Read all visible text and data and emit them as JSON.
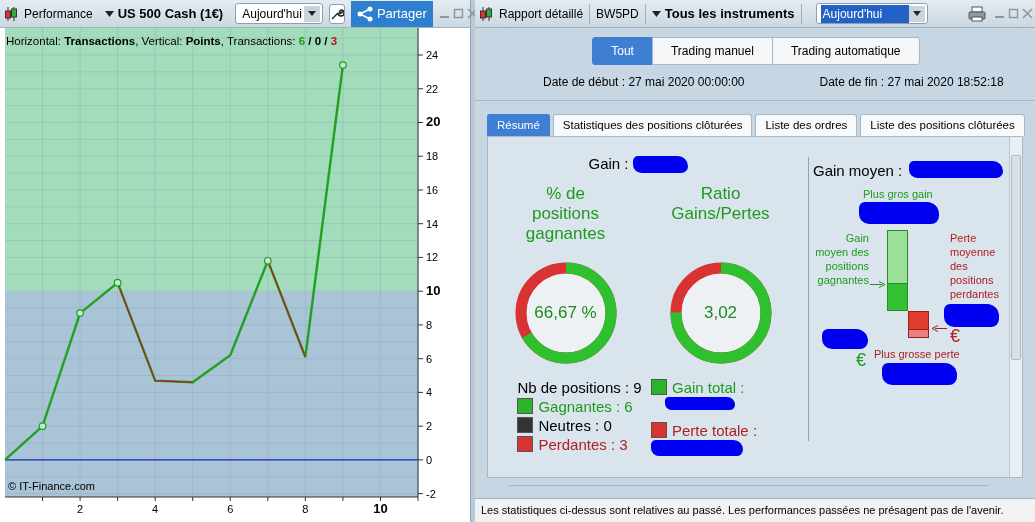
{
  "left_panel": {
    "toolbar": {
      "title": "Performance",
      "instrument": "US 500 Cash (1€)",
      "period": "Aujourd'hui",
      "share_button": "Partager"
    },
    "chart": {
      "caption": "Horizontal: **Transactions**, Vertical: **Points**, Transactions: ",
      "counts": [
        {
          "value": "6",
          "color": "#1f9a1f"
        },
        {
          "value": "0",
          "color": "#000000"
        },
        {
          "value": "3",
          "color": "#b81818"
        }
      ],
      "separator": " / ",
      "copyright": "© IT-Finance.com",
      "chart_data": {
        "type": "line",
        "x": [
          0,
          1,
          2,
          3,
          4,
          5,
          6,
          7,
          8,
          9
        ],
        "series": [
          {
            "color": "#22a022",
            "values": [
              0,
              2,
              8.7,
              10.5,
              4.7,
              4.6,
              6.2,
              11.8,
              6.1,
              23.4
            ]
          },
          {
            "color": "#b02020",
            "values": [
              null,
              null,
              null,
              10.5,
              4.7,
              4.6,
              null,
              11.8,
              6.1,
              null
            ]
          }
        ],
        "bands": [
          {
            "axis": "y",
            "from": -2.2,
            "to": 10,
            "color": "#a9c4d6"
          },
          {
            "axis": "y",
            "from": 10,
            "to": 25.6,
            "color": "#a2dcbb"
          }
        ],
        "ref_lines": [
          {
            "axis": "y",
            "value": 0,
            "color": "#1a2fb0"
          }
        ],
        "xlim": [
          0,
          11
        ],
        "ylim": [
          -2.2,
          25.6
        ],
        "xticks": [
          2,
          4,
          6,
          8,
          10
        ],
        "yticks": [
          -2,
          0,
          2,
          4,
          6,
          8,
          10,
          12,
          14,
          16,
          18,
          20,
          22,
          24
        ],
        "grid": true
      }
    }
  },
  "right_panel": {
    "toolbar": {
      "title": "Rapport détaillé",
      "account": "BW5PD",
      "instruments": "Tous les instruments",
      "period": "Aujourd'hui"
    },
    "modes": [
      {
        "label": "Tout",
        "selected": true
      },
      {
        "label": "Trading manuel",
        "selected": false
      },
      {
        "label": "Trading automatique",
        "selected": false
      }
    ],
    "start_date": {
      "label": "Date de début :",
      "value": "27 mai 2020 00:00:00"
    },
    "end_date": {
      "label": "Date de fin :",
      "value": "27 mai 2020 18:52:18"
    },
    "tabs": [
      {
        "label": "Résumé",
        "selected": true
      },
      {
        "label": "Statistiques des positions clôturées",
        "selected": false
      },
      {
        "label": "Liste des ordres",
        "selected": false
      },
      {
        "label": "Liste des positions clôturées",
        "selected": false
      }
    ],
    "summary": {
      "gain": {
        "label": "Gain :",
        "redacted": true
      },
      "win_rate": {
        "title": "% de positions gagnantes",
        "value": "66,67 %",
        "level": 0.6667
      },
      "ratio": {
        "title": "Ratio Gains/Pertes",
        "value": "3,02",
        "level": 0.751
      },
      "positions": {
        "label": "Nb de positions : 9",
        "items": [
          {
            "label": "Gagnantes : 6",
            "color": "#2ab52a"
          },
          {
            "label": "Neutres : 0",
            "color": "#333333"
          },
          {
            "label": "Perdantes : 3",
            "color": "#d83232"
          }
        ]
      },
      "totals": [
        {
          "label": "Gain total :",
          "color": "#2ab52a",
          "redacted": true
        },
        {
          "label": "Perte totale :",
          "color": "#d83232",
          "redacted": true
        }
      ],
      "average_gain": {
        "label": "Gain moyen :",
        "redacted": true
      },
      "diagram": {
        "best_gain": "Plus gros gain",
        "best_gain_redacted": true,
        "avg_win_label": "Gain moyen des positions gagnantes",
        "avg_win_redacted": true,
        "avg_loss_label": "Perte moyenne des positions perdantes",
        "avg_loss_redacted": true,
        "loss_currency": "€",
        "gain_currency": "€",
        "worst_loss": "Plus grosse perte",
        "worst_loss_redacted": true
      }
    },
    "status_bar": "Les statistiques ci-dessus sont relatives au passé. Les performances passées ne présagent pas de l'avenir."
  }
}
